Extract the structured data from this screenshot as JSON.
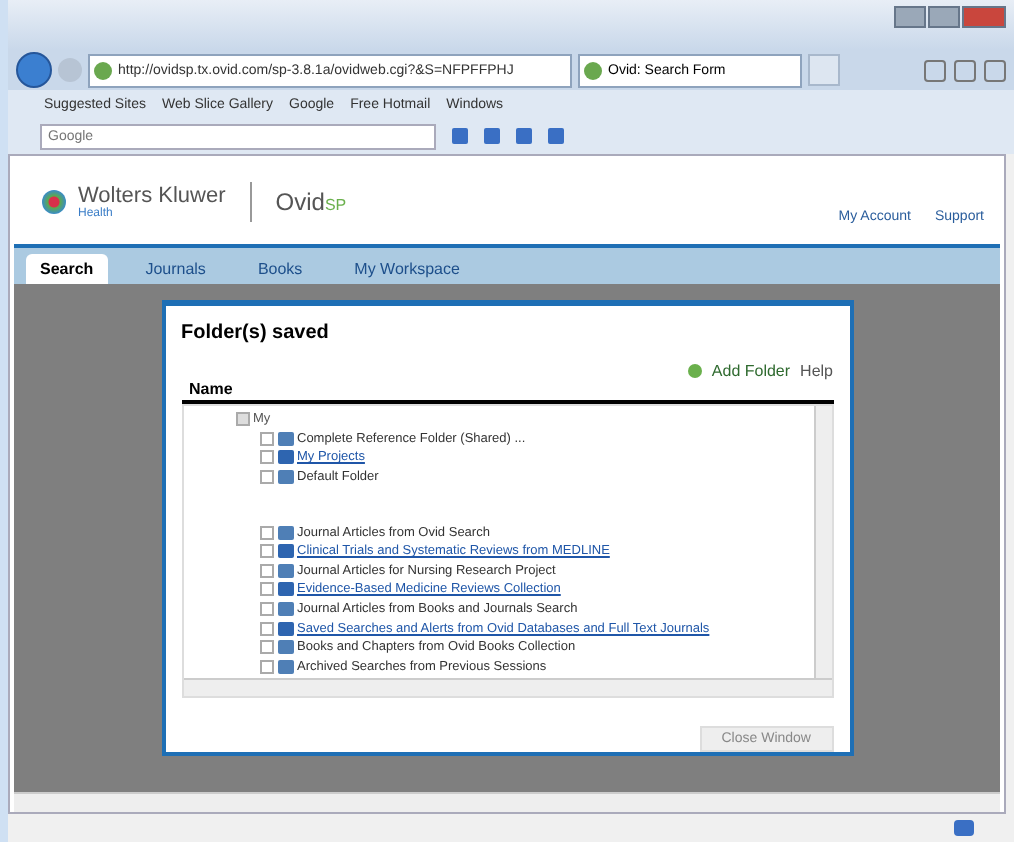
{
  "browser": {
    "address": "http://ovidsp.tx.ovid.com/sp-3.8.1a/ovidweb.cgi?&S=NFPFFPHJ",
    "tab_title": "Ovid: Search Form",
    "favorites": [
      "Suggested Sites",
      "Web Slice Gallery",
      "Google",
      "Free Hotmail",
      "Windows"
    ],
    "search_placeholder": "Google"
  },
  "header": {
    "brand": "Wolters Kluwer",
    "brand_sub": "Health",
    "product": "Ovid",
    "product_suffix": "SP",
    "links": [
      "My Account",
      "Support"
    ]
  },
  "nav": [
    {
      "label": "Search",
      "selected": true
    },
    {
      "label": "Journals",
      "selected": false
    },
    {
      "label": "Books",
      "selected": false
    },
    {
      "label": "My Workspace",
      "selected": false
    }
  ],
  "dialog": {
    "title": "Folder(s) saved",
    "actions": [
      "Add Folder",
      "Help"
    ],
    "column": "Name",
    "button": "Close Window",
    "tree": [
      {
        "label": "My",
        "kind": "root",
        "expanded": true,
        "children": [
          {
            "label": "Complete Reference Folder (Shared) ...",
            "kind": "plain"
          },
          {
            "label": "My Projects",
            "kind": "link"
          },
          {
            "label": "Default Folder",
            "kind": "plain"
          },
          {
            "kind": "spacer"
          },
          {
            "label": "Journal Articles from Ovid Search",
            "kind": "plain"
          },
          {
            "label": "Clinical Trials and Systematic Reviews from MEDLINE",
            "kind": "link"
          },
          {
            "label": "Journal Articles for Nursing Research Project",
            "kind": "plain"
          },
          {
            "label": "Evidence-Based Medicine Reviews Collection",
            "kind": "link"
          },
          {
            "label": "Journal Articles from Books and Journals Search",
            "kind": "plain"
          },
          {
            "label": "Saved Searches and Alerts from Ovid Databases and Full Text Journals",
            "kind": "link"
          },
          {
            "label": "Books and Chapters from Ovid Books Collection",
            "kind": "plain"
          },
          {
            "label": "Archived Searches from Previous Sessions",
            "kind": "plain"
          }
        ]
      }
    ]
  }
}
